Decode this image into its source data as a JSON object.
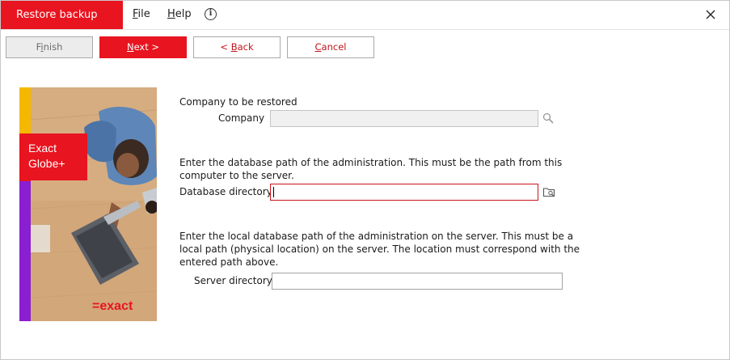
{
  "window": {
    "title": "Restore backup"
  },
  "menu": {
    "file": {
      "accel": "F",
      "rest": "ile"
    },
    "help": {
      "accel": "H",
      "rest": "elp"
    },
    "info_icon": "info-icon",
    "close_icon": "close-icon"
  },
  "toolbar": {
    "finish": {
      "pre": "F",
      "accel": "i",
      "post": "nish"
    },
    "next": {
      "pre": "",
      "accel": "N",
      "post": "ext >"
    },
    "back": {
      "pre": "< ",
      "accel": "B",
      "post": "ack"
    },
    "cancel": {
      "pre": "",
      "accel": "C",
      "post": "ancel"
    }
  },
  "hero": {
    "product_line1": "Exact",
    "product_line2": "Globe+",
    "brand": "=exact",
    "colors": {
      "red": "#e8141f",
      "yellow": "#f5b800",
      "purple": "#8a1fd1"
    }
  },
  "form": {
    "company_heading": "Company to be restored",
    "company_label": "Company",
    "company_value": "",
    "company_icon": "search-icon",
    "db_instruction_line1": "Enter the database path of the administration. This must be the path from this",
    "db_instruction_line2": "computer to the server.",
    "db_label": "Database directory",
    "db_value": "",
    "db_icon": "browse-folder-icon",
    "server_instruction_line1": "Enter the local database path of the administration on the server. This must be a",
    "server_instruction_line2": "local path (physical location) on the server. The location must correspond with the",
    "server_instruction_line3": "entered path above.",
    "server_label": "Server directory",
    "server_value": ""
  },
  "colors": {
    "accent": "#e8141f",
    "active_border": "#c8141c",
    "disabled_bg": "#f0f0f0"
  }
}
